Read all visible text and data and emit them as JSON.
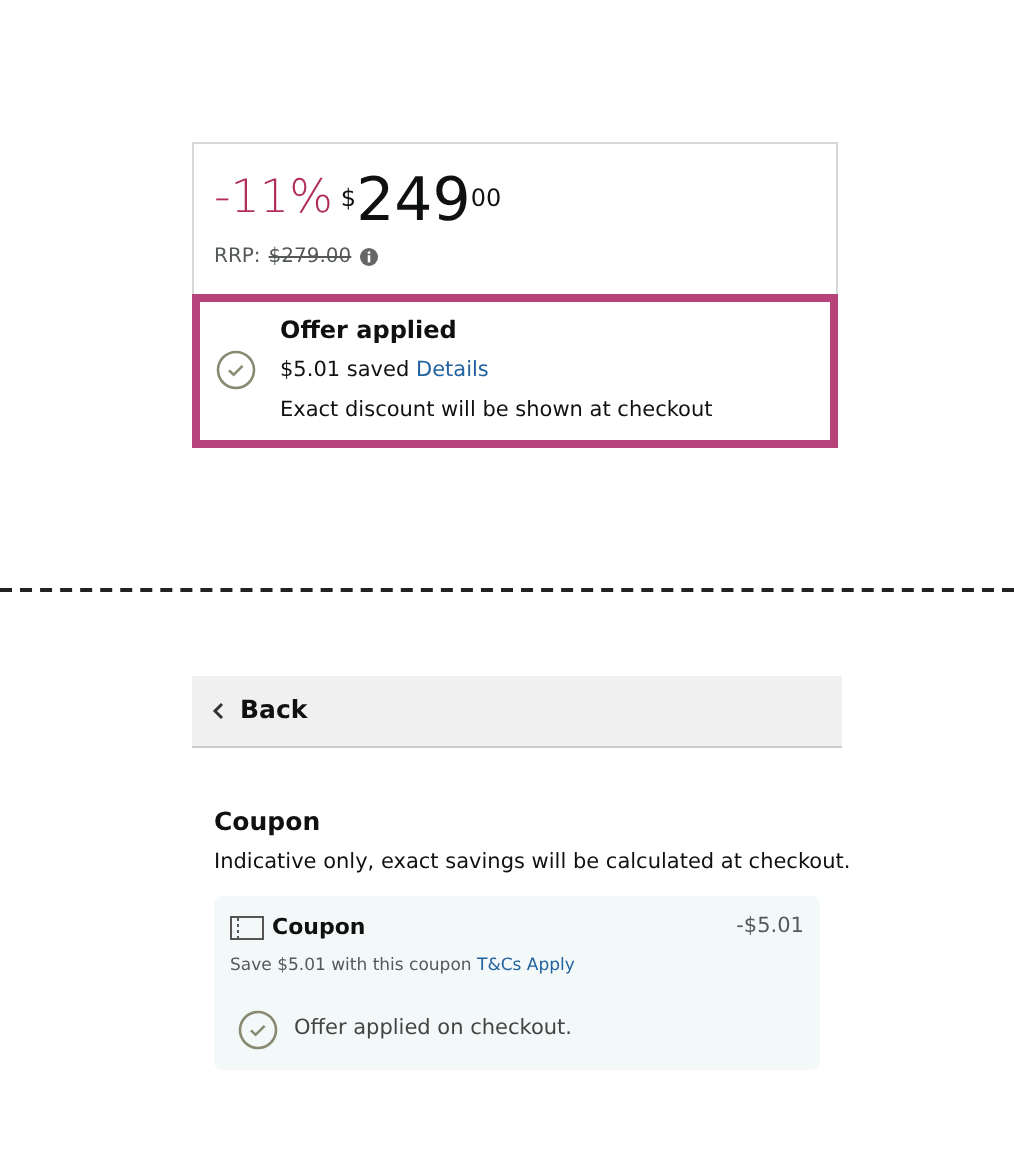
{
  "price_card": {
    "discount": "-11%",
    "currency": "$",
    "price_whole": "249",
    "price_fraction": "00",
    "rrp_label": "RRP:",
    "rrp_price": "$279.00"
  },
  "offer": {
    "highlighted": true,
    "title": "Offer applied",
    "saved": "$5.01 saved",
    "details_link": "Details",
    "note": "Exact discount will be shown at checkout"
  },
  "back_bar": {
    "label": "Back"
  },
  "coupon_section": {
    "title": "Coupon",
    "description": "Indicative only, exact savings will be calculated at checkout.",
    "coupon": {
      "name": "Coupon",
      "amount": "-$5.01",
      "text": "Save $5.01 with this coupon",
      "terms_link": "T&Cs Apply",
      "status": "Offer applied on checkout."
    }
  }
}
